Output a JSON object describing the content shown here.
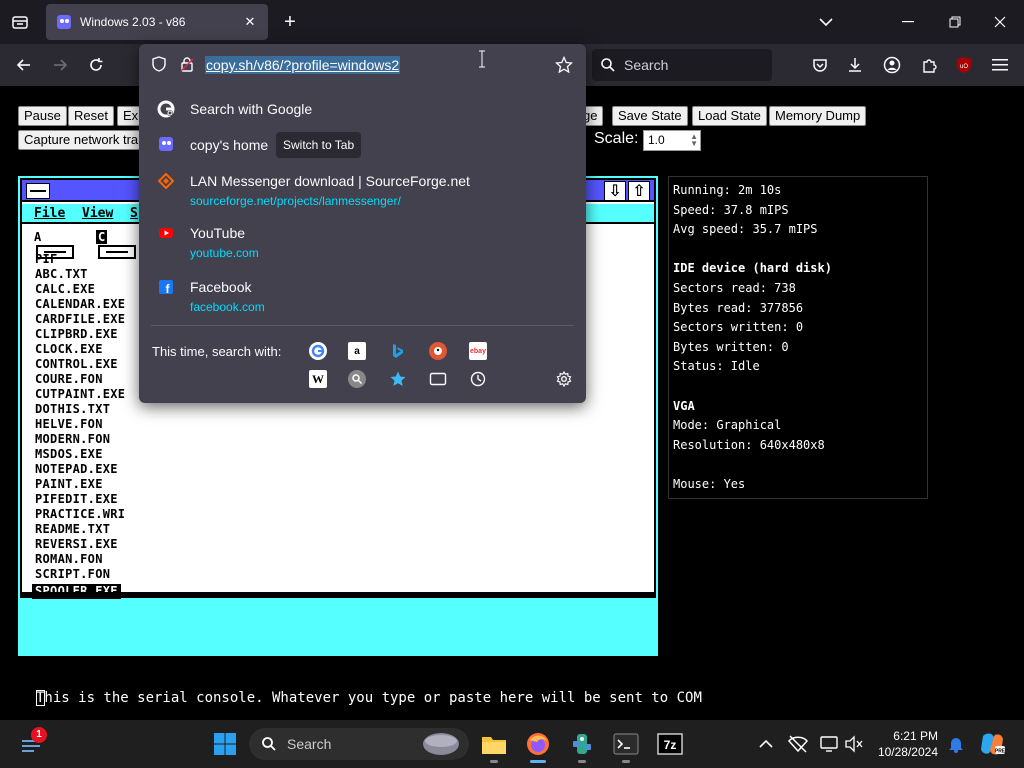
{
  "browser": {
    "tab_title": "Windows 2.03 - v86",
    "close_label": "✕",
    "new_tab_label": "+",
    "search_placeholder": "Search",
    "url": "copy.sh/v86/?profile=windows2"
  },
  "v86": {
    "buttons_row1": [
      "Pause",
      "Reset",
      "Exi",
      "ge",
      "Save State",
      "Load State",
      "Memory Dump"
    ],
    "buttons_row2": [
      "Capture network tra"
    ],
    "scale_label": "Scale:",
    "scale_value": "1.0"
  },
  "win2": {
    "menu": [
      "File",
      "View",
      "S"
    ],
    "drives": [
      "A",
      "C"
    ],
    "files": [
      "PIF",
      "ABC.TXT",
      "CALC.EXE",
      "CALENDAR.EXE",
      "CARDFILE.EXE",
      "CLIPBRD.EXE",
      "CLOCK.EXE",
      "CONTROL.EXE",
      "COURE.FON",
      "CUTPAINT.EXE",
      "DOTHIS.TXT",
      "HELVE.FON",
      "MODERN.FON",
      "MSDOS.EXE",
      "NOTEPAD.EXE",
      "PAINT.EXE",
      "PIFEDIT.EXE",
      "PRACTICE.WRI",
      "README.TXT",
      "REVERSI.EXE",
      "ROMAN.FON",
      "SCRIPT.FON",
      "SPOOLER.EXE"
    ],
    "selected_file": "SPOOLER.EXE"
  },
  "stats": {
    "running": "Running: 2m 10s",
    "speed": "Speed: 37.8 mIPS",
    "avg_speed": "Avg speed: 35.7 mIPS",
    "ide_header": "IDE device (hard disk)",
    "sectors_read": "Sectors read: 738",
    "bytes_read": "Bytes read: 377856",
    "sectors_written": "Sectors written: 0",
    "bytes_written": "Bytes written: 0",
    "status": "Status: Idle",
    "vga_header": "VGA",
    "mode": "Mode: Graphical",
    "resolution": "Resolution: 640x480x8",
    "mouse": "Mouse: Yes"
  },
  "serial": {
    "text": "This is the serial console. Whatever you type or paste here will be sent to COM"
  },
  "urlbar": {
    "results": [
      {
        "title": "Search with Google",
        "url": "",
        "icon": "google-icon"
      },
      {
        "title": "copy's home",
        "url": "",
        "icon": "v86-icon"
      },
      {
        "title": "LAN Messenger download | SourceForge.net",
        "url": "sourceforge.net/projects/lanmessenger/",
        "icon": "sourceforge-icon"
      },
      {
        "title": "YouTube",
        "url": "youtube.com",
        "icon": "youtube-icon"
      },
      {
        "title": "Facebook",
        "url": "facebook.com",
        "icon": "facebook-icon"
      }
    ],
    "switch_to_tab": "Switch to Tab",
    "this_time": "This time, search with:",
    "engines": [
      "google-icon",
      "amazon-icon",
      "bing-icon",
      "duckduckgo-icon",
      "ebay-icon",
      "wikipedia-icon",
      "search-icon",
      "bookmarks-icon",
      "tabs-icon",
      "history-icon"
    ]
  },
  "taskbar": {
    "search_label": "Search",
    "time": "6:21 PM",
    "date": "10/28/2024",
    "badge_count": "1"
  }
}
